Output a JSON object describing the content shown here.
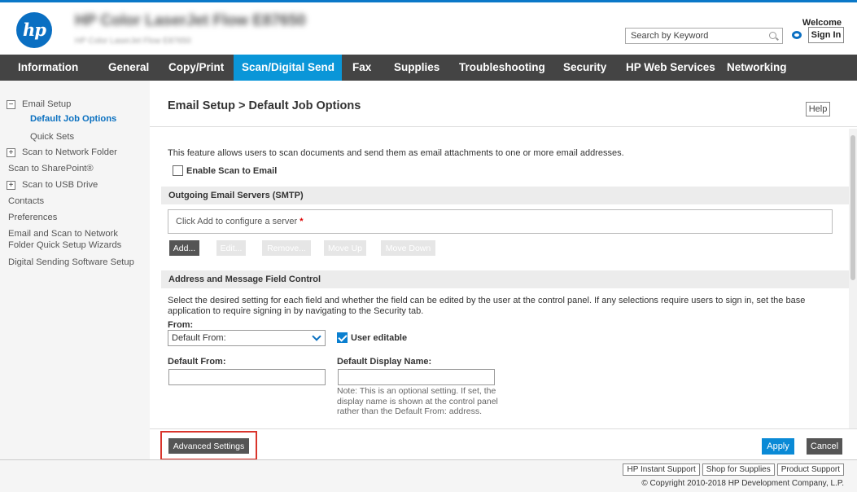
{
  "header": {
    "model_name": "HP Color LaserJet Flow E87650",
    "model_subtitle": "HP Color LaserJet Flow E87650",
    "search_placeholder": "Search by Keyword",
    "welcome": "Welcome",
    "sign_in": "Sign In",
    "logo_text": "hp"
  },
  "nav": {
    "tabs": [
      {
        "label": "Information"
      },
      {
        "label": "General"
      },
      {
        "label": "Copy/Print"
      },
      {
        "label": "Scan/Digital Send",
        "active": true
      },
      {
        "label": "Fax"
      },
      {
        "label": "Supplies"
      },
      {
        "label": "Troubleshooting"
      },
      {
        "label": "Security"
      },
      {
        "label": "HP Web Services"
      },
      {
        "label": "Networking"
      }
    ]
  },
  "sidebar": {
    "items": [
      {
        "label": "Email Setup",
        "toggle": "−"
      },
      {
        "label": "Default Job Options",
        "active": true
      },
      {
        "label": "Quick Sets"
      },
      {
        "label": "Scan to Network Folder",
        "toggle": "+"
      },
      {
        "label": "Scan to SharePoint®"
      },
      {
        "label": "Scan to USB Drive",
        "toggle": "+"
      },
      {
        "label": "Contacts"
      },
      {
        "label": "Preferences"
      },
      {
        "label": "Email and Scan to Network"
      },
      {
        "label": "Folder Quick Setup Wizards"
      },
      {
        "label": "Digital Sending Software Setup"
      }
    ]
  },
  "main": {
    "title": "Email Setup > Default Job Options",
    "help": "Help",
    "description": "This feature allows users to scan documents and send them as email attachments to one or more email addresses.",
    "enable_label": "Enable Scan to Email",
    "enable_checked": false,
    "smtp_section": "Outgoing Email Servers (SMTP)",
    "server_placeholder": "Click Add to configure a server",
    "server_required": "*",
    "server_buttons": {
      "add": "Add...",
      "edit": "Edit...",
      "remove": "Remove...",
      "move_up": "Move Up",
      "move_down": "Move Down"
    },
    "address_section": "Address and Message Field Control",
    "address_description": "Select the desired setting for each field and whether the field can be edited by the user at the control panel. If any selections require users to sign in, set the base application to require signing in by navigating to the Security tab.",
    "from_label": "From:",
    "from_selected": "Default From:",
    "user_editable_label": "User editable",
    "user_editable_checked": true,
    "default_from_label": "Default From:",
    "default_from_value": "",
    "display_name_label": "Default Display Name:",
    "display_name_value": "",
    "note": "Note: This is an optional setting. If set, the display name is shown at the control panel rather than the Default From: address."
  },
  "actions": {
    "advanced_settings": "Advanced Settings",
    "apply": "Apply",
    "cancel": "Cancel"
  },
  "footer": {
    "links": [
      "HP Instant Support",
      "Shop for Supplies",
      "Product Support"
    ],
    "copyright": "© Copyright 2010-2018 HP Development Company, L.P."
  },
  "colors": {
    "accent": "#0a96d8",
    "nav_bg": "#444444",
    "highlight_outline": "#d9342b"
  }
}
